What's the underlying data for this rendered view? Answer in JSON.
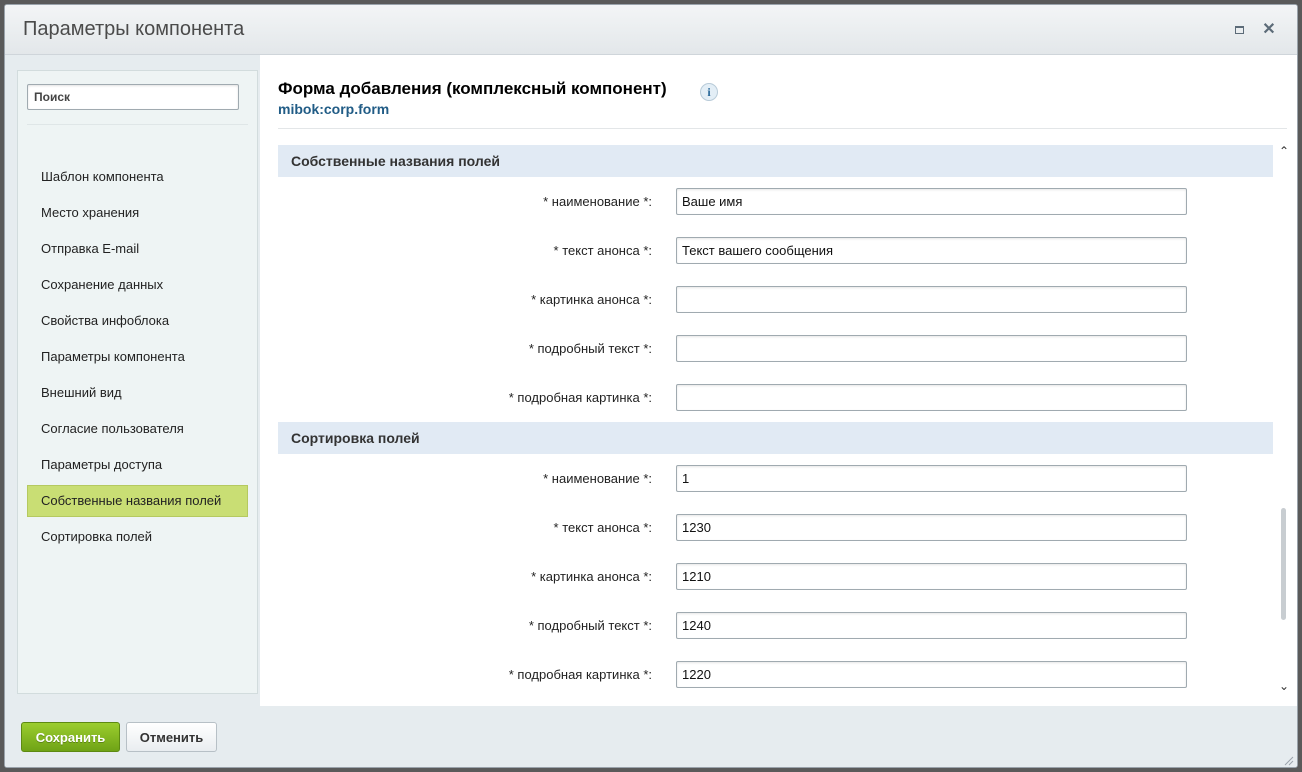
{
  "window": {
    "title": "Параметры компонента"
  },
  "sidebar": {
    "search_placeholder": "Поиск",
    "items": [
      {
        "label": "Шаблон компонента"
      },
      {
        "label": "Место хранения"
      },
      {
        "label": "Отправка E-mail"
      },
      {
        "label": "Сохранение данных"
      },
      {
        "label": "Свойства инфоблока"
      },
      {
        "label": "Параметры компонента"
      },
      {
        "label": "Внешний вид"
      },
      {
        "label": "Согласие пользователя"
      },
      {
        "label": "Параметры доступа"
      },
      {
        "label": "Собственные названия полей",
        "active": true
      },
      {
        "label": "Сортировка полей"
      }
    ]
  },
  "main": {
    "title": "Форма добавления (комплексный компонент)",
    "info_icon": "info-icon",
    "code": "mibok:corp.form",
    "sections": [
      {
        "title": "Собственные названия полей",
        "fields": [
          {
            "label": "* наименование *:",
            "value": "Ваше имя"
          },
          {
            "label": "* текст анонса *:",
            "value": "Текст вашего сообщения"
          },
          {
            "label": "* картинка анонса *:",
            "value": ""
          },
          {
            "label": "* подробный текст *:",
            "value": ""
          },
          {
            "label": "* подробная картинка *:",
            "value": ""
          }
        ]
      },
      {
        "title": "Сортировка полей",
        "fields": [
          {
            "label": "* наименование *:",
            "value": "1"
          },
          {
            "label": "* текст анонса *:",
            "value": "1230"
          },
          {
            "label": "* картинка анонса *:",
            "value": "1210"
          },
          {
            "label": "* подробный текст *:",
            "value": "1240"
          },
          {
            "label": "* подробная картинка *:",
            "value": "1220"
          }
        ]
      }
    ]
  },
  "footer": {
    "save_label": "Сохранить",
    "cancel_label": "Отменить"
  },
  "colors": {
    "active_item": "#c9de74",
    "save_button": "#7fb41e",
    "section_header": "#e1eaf4",
    "code_link": "#215c86"
  }
}
